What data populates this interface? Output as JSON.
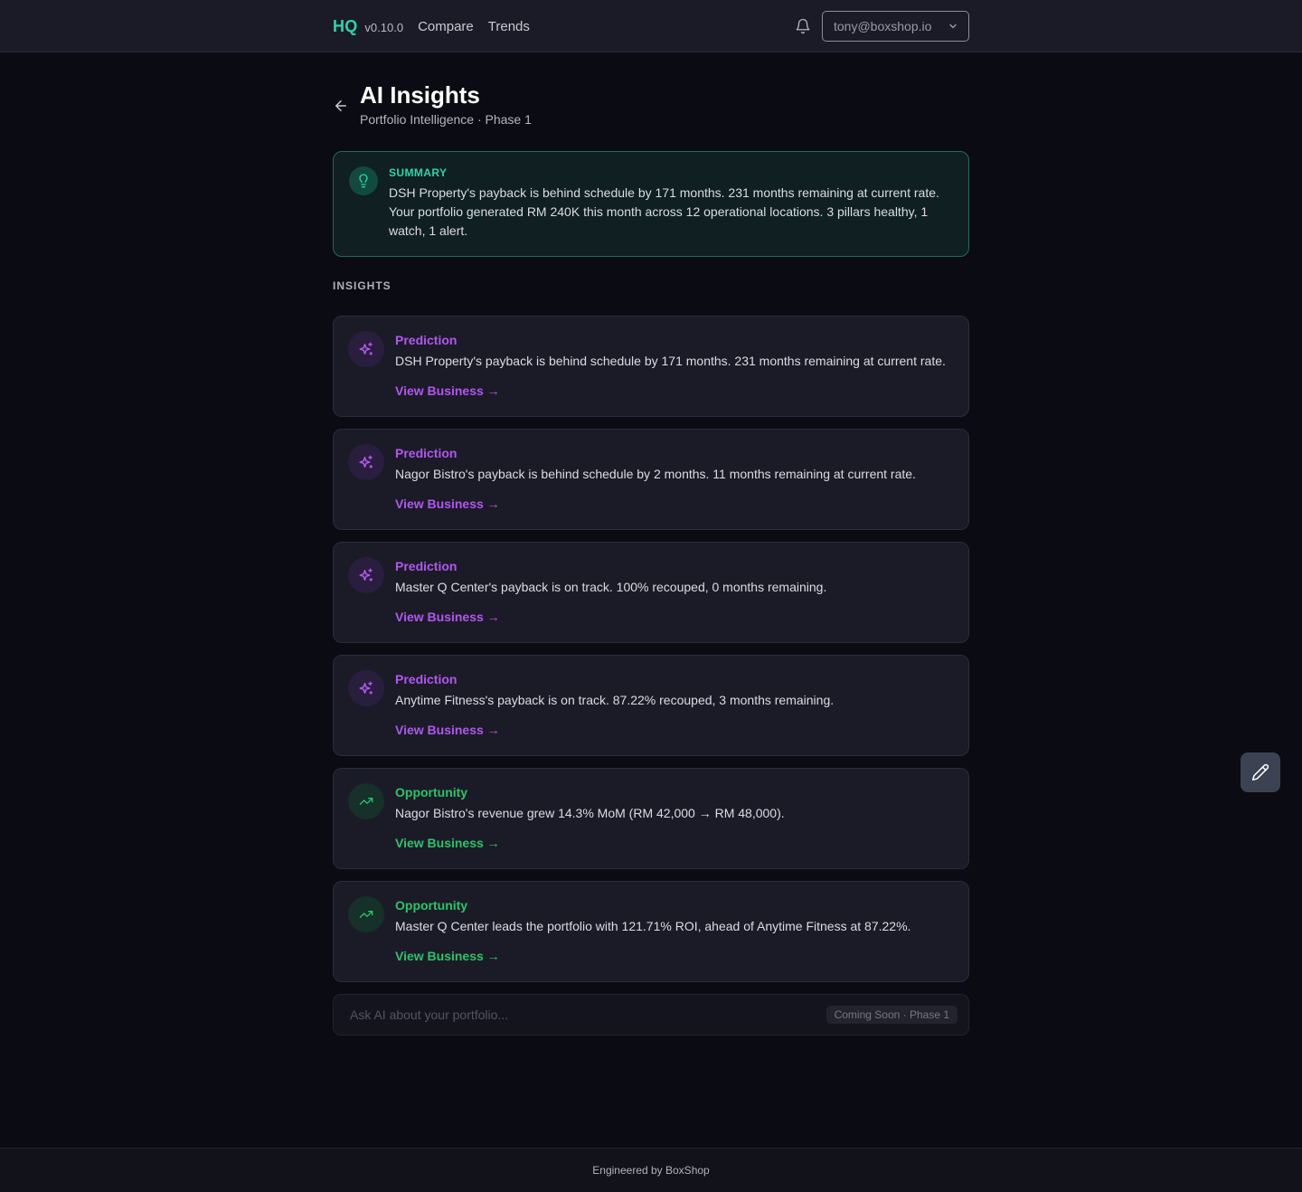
{
  "nav": {
    "brand": "HQ",
    "version": "v0.10.0",
    "links": [
      "Compare",
      "Trends"
    ],
    "account": "tony@boxshop.io"
  },
  "header": {
    "title": "AI Insights",
    "subtitle": "Portfolio Intelligence · Phase 1"
  },
  "summary": {
    "label": "SUMMARY",
    "text": "DSH Property's payback is behind schedule by 171 months. 231 months remaining at current rate. Your portfolio generated RM 240K this month across 12 operational locations. 3 pillars healthy, 1 watch, 1 alert."
  },
  "insights": {
    "label": "INSIGHTS",
    "items": [
      {
        "type": "Prediction",
        "text": "DSH Property's payback is behind schedule by 171 months. 231 months remaining at current rate.",
        "link": "View Business →"
      },
      {
        "type": "Prediction",
        "text": "Nagor Bistro's payback is behind schedule by 2 months. 11 months remaining at current rate.",
        "link": "View Business →"
      },
      {
        "type": "Prediction",
        "text": "Master Q Center's payback is on track. 100% recouped, 0 months remaining.",
        "link": "View Business →"
      },
      {
        "type": "Prediction",
        "text": "Anytime Fitness's payback is on track. 87.22% recouped, 3 months remaining.",
        "link": "View Business →"
      },
      {
        "type": "Opportunity",
        "text": "Nagor Bistro's revenue grew 14.3% MoM (RM 42,000 → RM 48,000).",
        "link": "View Business →"
      },
      {
        "type": "Opportunity",
        "text": "Master Q Center leads the portfolio with 121.71% ROI, ahead of Anytime Fitness at 87.22%.",
        "link": "View Business →"
      }
    ]
  },
  "ask": {
    "placeholder": "Ask AI about your portfolio...",
    "badge": "Coming Soon · Phase 1"
  },
  "footer": {
    "text": "Engineered by BoxShop"
  },
  "colors": {
    "brand": "#2dd4a7",
    "prediction": "#b157f0",
    "opportunity": "#2bc46a"
  },
  "icons": {
    "prediction": "sparkle-icon",
    "opportunity": "trending-up-icon",
    "summary": "lightbulb-icon"
  }
}
